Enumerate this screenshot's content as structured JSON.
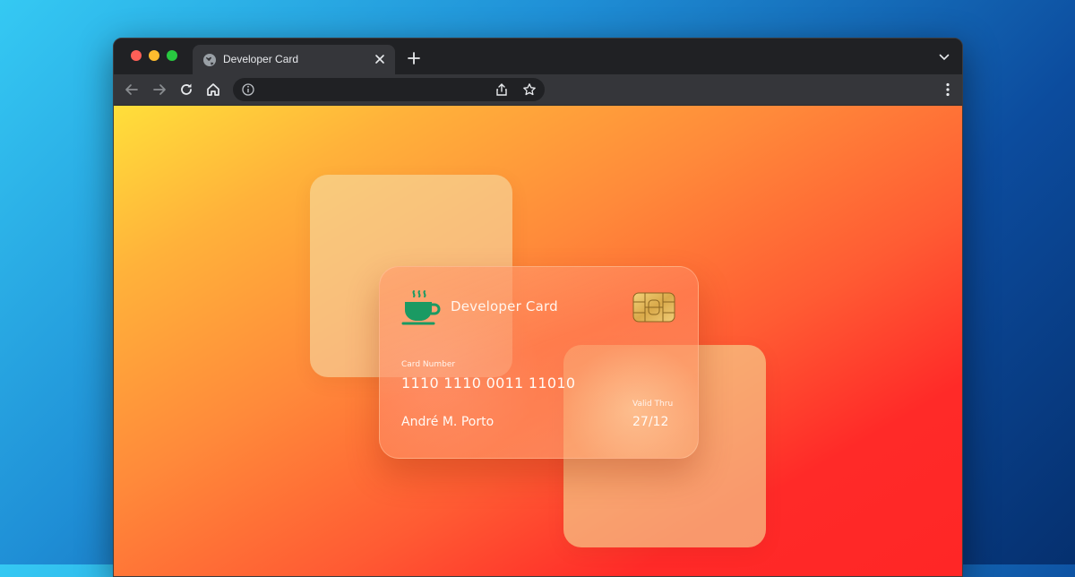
{
  "window": {
    "traffic_lights": {
      "close_color": "#ff5f57",
      "minimize_color": "#febc2e",
      "maximize_color": "#28c840"
    }
  },
  "tab": {
    "title": "Developer Card",
    "icon": "globe-icon"
  },
  "toolbar": {
    "url_value": "",
    "icons": [
      "back-arrow-icon",
      "forward-arrow-icon",
      "reload-icon",
      "home-icon",
      "info-icon",
      "share-icon",
      "star-icon",
      "kebab-menu-icon"
    ]
  },
  "page": {
    "background_colors": [
      "#ffdf3a",
      "#ff8a3a",
      "#ff2626"
    ],
    "card": {
      "brand": "Developer Card",
      "brand_icon": "coffee-cup-icon",
      "brand_icon_color": "#1a9a63",
      "chip_icon": "card-chip-icon",
      "number_label": "Card Number",
      "number": "1110 1110 0011 11010",
      "holder": "André M. Porto",
      "valid_label": "Valid Thru",
      "valid": "27/12"
    }
  }
}
